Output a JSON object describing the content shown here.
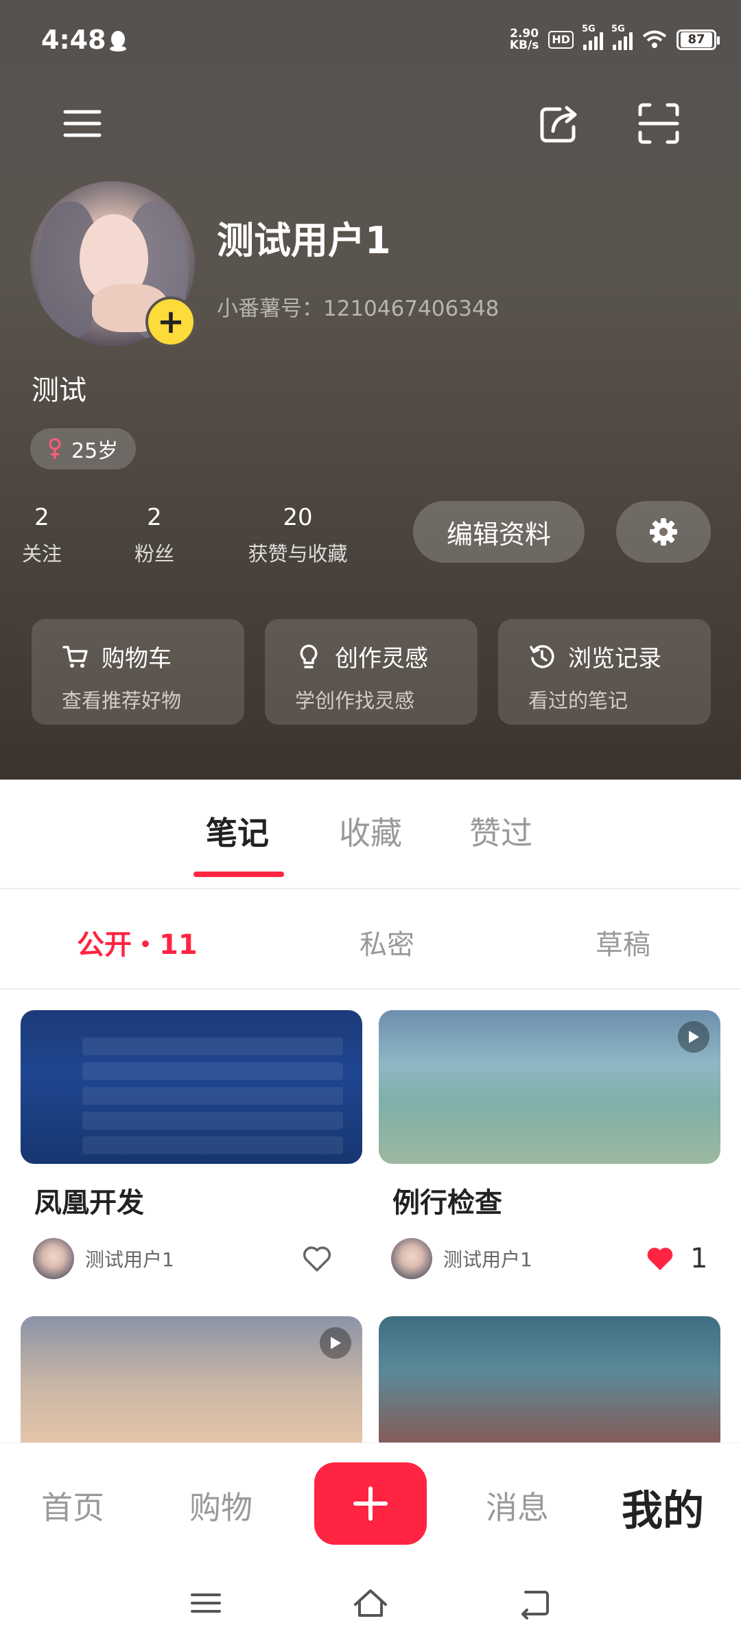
{
  "status_bar": {
    "time": "4:48",
    "net_speed_value": "2.90",
    "net_speed_unit": "KB/s",
    "hd_label": "HD",
    "signal_1": "5G",
    "signal_2": "5G",
    "battery": "87"
  },
  "top_bar": {
    "icons": [
      "menu-icon",
      "share-icon",
      "scan-icon"
    ]
  },
  "profile": {
    "username": "测试用户1",
    "user_id": "小番薯号：1210467406348",
    "bio": "测试",
    "age": "25岁",
    "gender_icon": "female-icon"
  },
  "stats": [
    {
      "value": "2",
      "label": "关注"
    },
    {
      "value": "2",
      "label": "粉丝"
    },
    {
      "value": "20",
      "label": "获赞与收藏"
    }
  ],
  "actions": {
    "edit_label": "编辑资料",
    "settings_icon": "gear-icon"
  },
  "cards": [
    {
      "title": "购物车",
      "subtitle": "查看推荐好物",
      "icon": "cart-icon"
    },
    {
      "title": "创作灵感",
      "subtitle": "学创作找灵感",
      "icon": "bulb-icon"
    },
    {
      "title": "浏览记录",
      "subtitle": "看过的笔记",
      "icon": "history-icon"
    }
  ],
  "main_tabs": [
    "笔记",
    "收藏",
    "赞过"
  ],
  "sub_tabs": [
    "公开・11",
    "私密",
    "草稿"
  ],
  "notes": [
    {
      "title": "凤凰开发",
      "author": "测试用户1",
      "liked": false,
      "likes": ""
    },
    {
      "title": "例行检查",
      "author": "测试用户1",
      "liked": true,
      "likes": "1"
    }
  ],
  "bottom_nav": [
    "首页",
    "购物",
    "消息",
    "我的"
  ],
  "colors": {
    "accent": "#ff2442",
    "avatar_badge": "#fddb3a"
  }
}
